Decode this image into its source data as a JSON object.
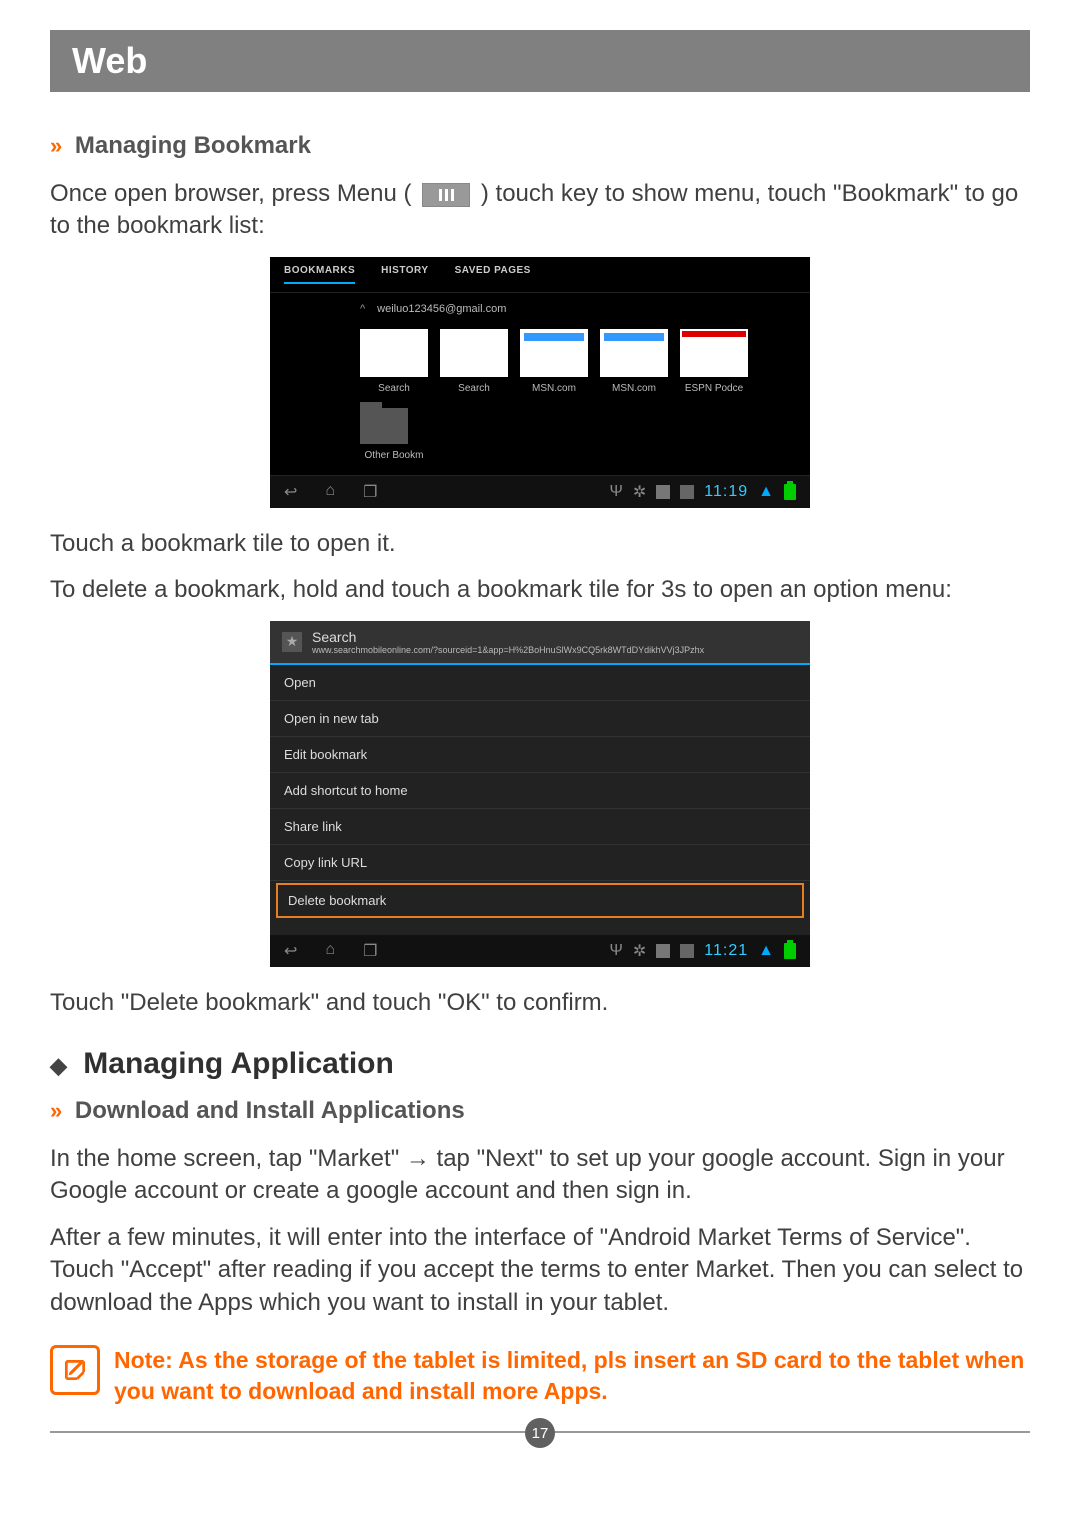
{
  "header": "Web",
  "section1": {
    "title": "Managing Bookmark",
    "intro_a": "Once open browser, press Menu (",
    "intro_b": ") touch key to show menu, touch \"Bookmark\" to go to the bookmark list:",
    "after_shot1": "Touch a bookmark tile to open it.",
    "delete_intro": "To delete a bookmark, hold and touch a bookmark tile for 3s to open an option menu:",
    "after_shot2": "Touch \"Delete bookmark\" and touch \"OK\" to confirm."
  },
  "shot1": {
    "tabs": [
      "BOOKMARKS",
      "HISTORY",
      "SAVED PAGES"
    ],
    "account": "weiluo123456@gmail.com",
    "thumbs": [
      "Search",
      "Search",
      "MSN.com",
      "MSN.com",
      "ESPN Podce"
    ],
    "folder_label": "Other Bookm",
    "clock": "11:19"
  },
  "shot2": {
    "title": "Search",
    "url": "www.searchmobileonline.com/?sourceid=1&app=H%2BoHnuSlWx9CQ5rk8WTdDYdikhVVj3JPzhx",
    "items": [
      "Open",
      "Open in new tab",
      "Edit bookmark",
      "Add shortcut to home",
      "Share link",
      "Copy link URL",
      "Delete bookmark"
    ],
    "clock": "11:21"
  },
  "section2": {
    "title": "Managing Application",
    "sub": "Download and Install Applications",
    "p1": "In the home screen, tap \"Market\" → tap \"Next\" to set up your google account. Sign in your Google account or create a google account and then sign in.",
    "p2": "After a few minutes, it will enter into the interface of \"Android Market Terms of Service\". Touch \"Accept\" after reading if you accept the terms to enter Market. Then you can select to download the Apps which you want to install in your tablet."
  },
  "note": "Note: As the storage of the tablet is limited, pls insert an SD card to the tablet when you want to download and install more Apps.",
  "page_number": "17"
}
